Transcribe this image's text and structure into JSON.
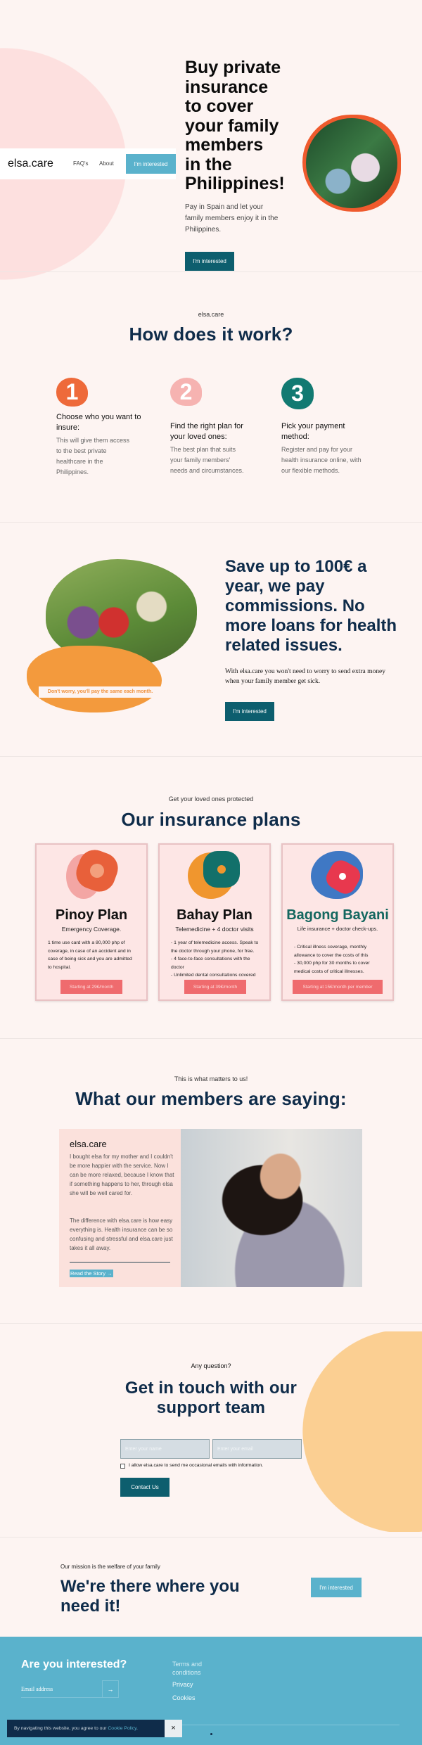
{
  "nav": {
    "logo": "elsa.care",
    "links": [
      "FAQ's",
      "About"
    ],
    "cta": "I'm interested"
  },
  "hero": {
    "title": "Buy private insurance to cover your family members in the Philippines!",
    "text": "Pay in Spain and let your family members enjoy it in the Philippines.",
    "cta": "I'm interested"
  },
  "how": {
    "eyebrow": "elsa.care",
    "title": "How does it work?",
    "steps": [
      {
        "num": "1",
        "title": "Choose who you want to insure:",
        "text": "This will give them access to the best private healthcare in the Philippines.",
        "color": "#ee6a3a"
      },
      {
        "num": "2",
        "title": "Find the right plan for your loved ones:",
        "text": "The best plan that suits your family members' needs and circumstances.",
        "color": "#f6b3b1"
      },
      {
        "num": "3",
        "title": "Pick your payment method:",
        "text": "Register and pay for your health insurance online, with our flexible methods.",
        "color": "#127a72"
      }
    ]
  },
  "save": {
    "title": "Save up to 100€ a year, we pay commissions. No more loans for health related issues.",
    "text": "With elsa.care you won't need to worry to send extra money when your family member get sick.",
    "caption": "Don't worry, you'll pay the same each month.",
    "cta": "I'm interested"
  },
  "plans": {
    "eyebrow": "Get your loved ones protected",
    "title": "Our insurance plans",
    "items": [
      {
        "name": "Pinoy Plan",
        "subtitle": "Emergency Coverage.",
        "desc": "1 time use card with a 80,000 php of coverage, in case of an accident and in case of being sick and you are admitted to hospital.",
        "cta": "Starting at 29€/month"
      },
      {
        "name": "Bahay Plan",
        "subtitle": "Telemedicine + 4 doctor visits",
        "desc": "- 1 year of telemedicine access. Speak to the doctor through your phone, for free.\n- 4 face-to-face consultations with the doctor\n- Unlimited dental consultations covered",
        "cta": "Starting at 39€/month"
      },
      {
        "name": "Bagong Bayani",
        "subtitle": "Life insurance + doctor check-ups.",
        "desc": "- Critical illness coverage, monthly allowance to cover the costs of this\n- 30,000 php for 30 months to cover medical costs of critical illnesses.",
        "cta": "Starting at 15€/month per member"
      }
    ]
  },
  "testimonials": {
    "eyebrow": "This is what matters to us!",
    "title": "What our members are saying:",
    "brand": "elsa.care",
    "quote1": "I bought elsa for my mother and I couldn't be more happier with the service. Now I can be more relaxed, because I know that if something happens to her, through elsa she will be well cared for.",
    "quote2": "The difference with elsa.care is how easy everything is. Health insurance can be so confusing and stressful and elsa.care just takes it all away.",
    "link": "Read the Story →"
  },
  "contact": {
    "eyebrow": "Any question?",
    "title": "Get in touch with our support team",
    "name_placeholder": "Enter your name",
    "email_placeholder": "Enter your email",
    "consent": "I allow elsa.care to send me occasional emails with information.",
    "cta": "Contact Us"
  },
  "mission": {
    "eyebrow": "Our mission is the welfare of your family",
    "title": "We're there where you need it!",
    "cta": "I'm interested"
  },
  "footer": {
    "title": "Are you interested?",
    "email_placeholder": "Email address",
    "submit": "→",
    "links": [
      "Terms and conditions",
      "Privacy",
      "Cookies"
    ]
  },
  "cookie": {
    "text": "By navigating this website, you agree to our ",
    "link": "Cookie Policy",
    "suffix": ".",
    "close": "×"
  }
}
